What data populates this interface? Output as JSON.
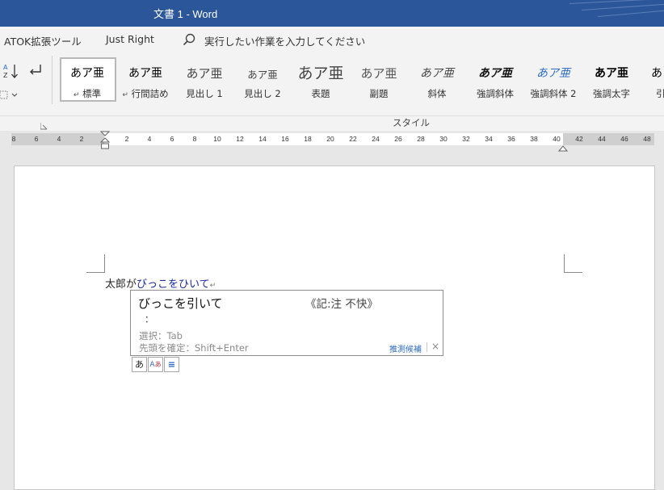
{
  "window": {
    "title": "文書 1  -  Word"
  },
  "menu": {
    "items": [
      "ATOK拡張ツール",
      "Just Right"
    ],
    "search_icon": "search-icon",
    "search_text": "実行したい作業を入力してください"
  },
  "ribbon": {
    "group_label": "スタイル",
    "styles": [
      {
        "sample": "あア亜",
        "label": "標準",
        "mark": "↵",
        "selected": true
      },
      {
        "sample": "あア亜",
        "label": "行間詰め",
        "mark": "↵"
      },
      {
        "sample": "あア亜",
        "label": "見出し 1"
      },
      {
        "sample": "あア亜",
        "label": "見出し 2"
      },
      {
        "sample": "あア亜",
        "label": "表題"
      },
      {
        "sample": "あア亜",
        "label": "副題"
      },
      {
        "sample": "あア亜",
        "label": "斜体"
      },
      {
        "sample": "あア亜",
        "label": "強調斜体"
      },
      {
        "sample": "あア亜",
        "label": "強調斜体 2"
      },
      {
        "sample": "あア亜",
        "label": "強調太字"
      },
      {
        "sample": "あ",
        "label": "引"
      }
    ]
  },
  "ruler": {
    "left_numbers": [
      "8",
      "6",
      "4",
      "2"
    ],
    "right_numbers": [
      "2",
      "4",
      "6",
      "8",
      "10",
      "12",
      "14",
      "16",
      "18",
      "20",
      "22",
      "24",
      "26",
      "28",
      "30",
      "32",
      "34",
      "36",
      "38",
      "40",
      "42",
      "44",
      "46",
      "48"
    ]
  },
  "document": {
    "text_plain": "太郎が",
    "text_composing": "びっこをひいて",
    "para_mark": "↵"
  },
  "ime": {
    "candidate": "びっこを引いて",
    "note": "《記:注 不快》",
    "colon": "：",
    "hint_select": "選択：Tab",
    "hint_confirm": "先頭を確定：Shift+Enter",
    "predict_label": "推測候補",
    "close": "×",
    "tools": [
      "あ",
      "A",
      "≡"
    ]
  },
  "colors": {
    "titlebar": "#2b579a",
    "composing_text": "#1a2a9e",
    "link": "#2e6bc6"
  }
}
